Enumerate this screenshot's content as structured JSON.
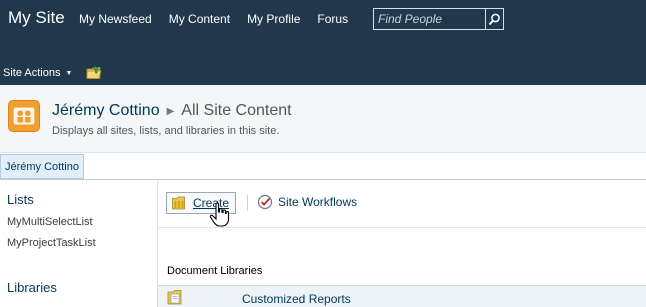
{
  "topbar": {
    "site_title": "My Site",
    "nav": [
      "My Newsfeed",
      "My Content",
      "My Profile",
      "Forus"
    ],
    "search_placeholder": "Find People",
    "site_actions_label": "Site Actions"
  },
  "page_header": {
    "site_name": "Jérémy Cottino",
    "page_title": "All Site Content",
    "description": "Displays all sites, lists, and libraries in this site."
  },
  "tabs": {
    "active": "Jérémy Cottino"
  },
  "left_nav": {
    "lists_heading": "Lists",
    "lists": [
      "MyMultiSelectList",
      "MyProjectTaskList"
    ],
    "libraries_heading": "Libraries"
  },
  "toolbar": {
    "create_label": "Create",
    "workflows_label": "Site Workflows"
  },
  "content": {
    "section_label": "Document Libraries",
    "rows": [
      {
        "name": "Customized Reports"
      }
    ]
  },
  "colors": {
    "topbar_bg": "#21374c",
    "link": "#003759",
    "accent_orange": "#f0a030"
  },
  "icons": {
    "search": "magnifier-icon",
    "nav_folder": "folder-up-icon",
    "page": "people-icon",
    "create": "create-folder-icon",
    "workflows": "workflow-icon",
    "library": "document-library-icon",
    "cursor": "hand-cursor-icon"
  }
}
